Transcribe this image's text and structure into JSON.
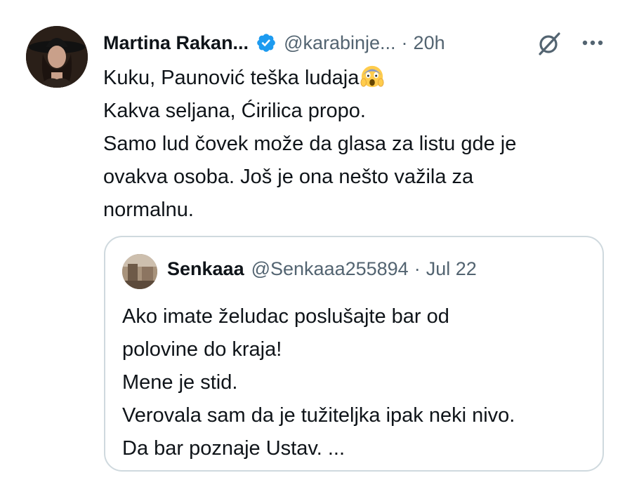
{
  "tweet": {
    "author": {
      "display_name": "Martina Rakan...",
      "handle": "@karabinje...",
      "verified": true,
      "avatar_icon": "profile-photo-woman-hat"
    },
    "separator": "·",
    "time": "20h",
    "actions": {
      "grok_icon": "grok-icon",
      "more_icon": "more-icon"
    },
    "text_lines": [
      "Kuku, Paunović teška ludaja",
      "Kakva seljana, Ćirilica propo.",
      "Samo lud čovek može da glasa za listu gde je",
      "ovakva osoba. Još je ona nešto važila za",
      "normalnu."
    ],
    "emoji": "face-screaming-in-fear",
    "quoted_tweet": {
      "author": {
        "display_name": "Senkaaa",
        "handle": "@Senkaaa255894"
      },
      "separator": "·",
      "time": "Jul 22",
      "text_lines": [
        "Ako imate želudac poslušajte bar od",
        "polovine do kraja!",
        "Mene je stid.",
        "Verovala sam da je tužiteljka ipak neki nivo.",
        "Da bar poznaje Ustav. ..."
      ]
    }
  },
  "colors": {
    "text_primary": "#0f1419",
    "text_secondary": "#536471",
    "verified_blue": "#1d9bf0",
    "border": "#cfd9de"
  }
}
